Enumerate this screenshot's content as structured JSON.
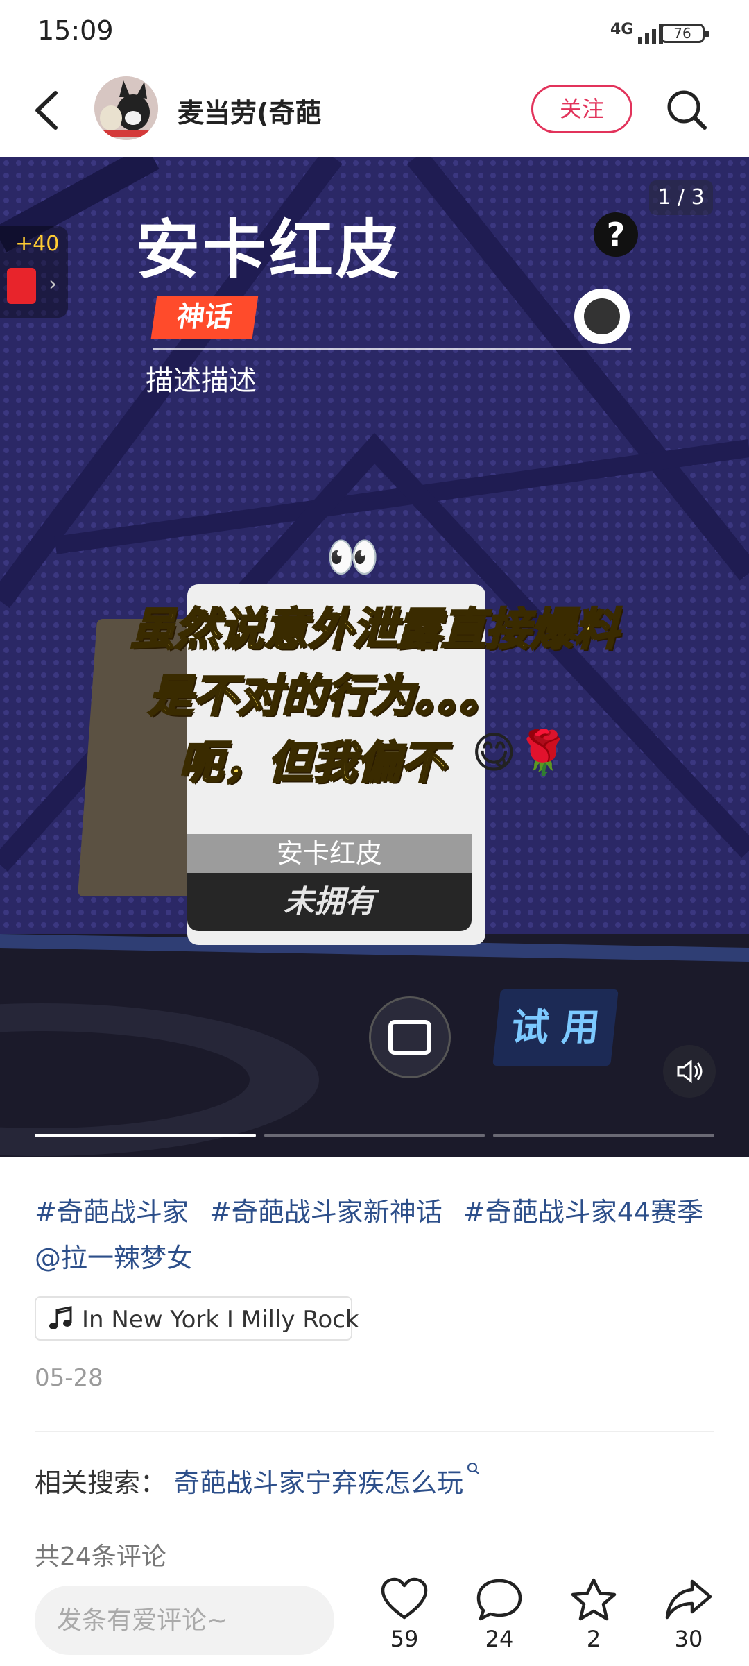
{
  "status_bar": {
    "time": "15:09",
    "network": "4G",
    "battery": "76"
  },
  "header": {
    "username": "麦当劳(奇葩",
    "follow_label": "关注"
  },
  "media": {
    "page_counter": "1 / 3",
    "skin_title": "安卡红皮",
    "rarity": "神话",
    "description": "描述描述",
    "redpacket_bonus": "+40",
    "card_name": "安卡红皮",
    "card_status": "未拥有",
    "try_label": "试 用",
    "caption_lines": [
      "虽然说意外泄露直接爆料",
      "是不对的行为。。。",
      "呃，但我偏不"
    ],
    "eyes_emoji": "👀",
    "caption_emoji": "😋🌹",
    "total_pages": 3,
    "current_page": 1
  },
  "post": {
    "hashtags": [
      "#奇葩战斗家",
      "#奇葩战斗家新神话",
      "#奇葩战斗家44赛季",
      "@拉一辣梦女"
    ],
    "music": "In New York I Milly Rock",
    "date": "05-28",
    "related_label": "相关搜索：",
    "related_query": "奇葩战斗家宁弃疾怎么玩",
    "comments_count": "共24条评论"
  },
  "bottom_bar": {
    "comment_placeholder": "发条有爱评论~",
    "likes": "59",
    "comments": "24",
    "favorites": "2",
    "shares": "30"
  },
  "colors": {
    "accent": "#e2335b",
    "link": "#2d4f8a",
    "media_bg": "#2d2a6b"
  }
}
